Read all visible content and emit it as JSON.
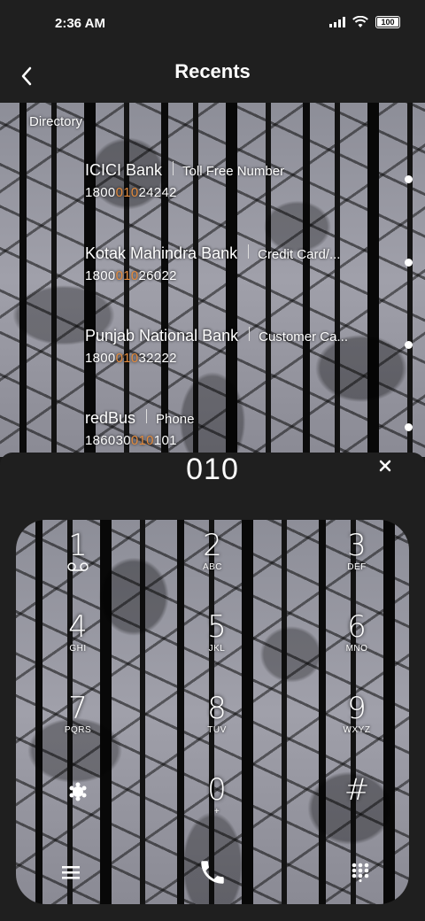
{
  "status": {
    "time": "2:36 AM",
    "battery": "100"
  },
  "header": {
    "title": "Recents"
  },
  "directory": {
    "label": "Directory",
    "entries": [
      {
        "name": "ICICI Bank",
        "tag": "Toll Free Number",
        "num_pre": "1800",
        "num_hl": "010",
        "num_post": "24242"
      },
      {
        "name": "Kotak Mahindra Bank",
        "tag": "Credit Card/...",
        "num_pre": "1800",
        "num_hl": "010",
        "num_post": "26022"
      },
      {
        "name": "Punjab National Bank",
        "tag": "Customer Ca...",
        "num_pre": "1800",
        "num_hl": "010",
        "num_post": "32222"
      },
      {
        "name": "redBus",
        "tag": "Phone",
        "num_pre": "186030",
        "num_hl": "010",
        "num_post": "101"
      }
    ]
  },
  "dialer": {
    "input": "010",
    "clear_icon": "close-icon",
    "keys": [
      {
        "digit": "1",
        "letters": "ᴼᴼ"
      },
      {
        "digit": "2",
        "letters": "ABC"
      },
      {
        "digit": "3",
        "letters": "DEF"
      },
      {
        "digit": "4",
        "letters": "GHI"
      },
      {
        "digit": "5",
        "letters": "JKL"
      },
      {
        "digit": "6",
        "letters": "MNO"
      },
      {
        "digit": "7",
        "letters": "PQRS"
      },
      {
        "digit": "8",
        "letters": "TUV"
      },
      {
        "digit": "9",
        "letters": "WXYZ"
      },
      {
        "digit": "*",
        "letters": ""
      },
      {
        "digit": "0",
        "letters": "+"
      },
      {
        "digit": "#",
        "letters": ""
      }
    ],
    "bottom_icons": [
      "menu-icon",
      "phone-icon",
      "keypad-icon"
    ]
  },
  "colors": {
    "highlight": "#e38a3c",
    "panel": "#1f1f1f"
  }
}
